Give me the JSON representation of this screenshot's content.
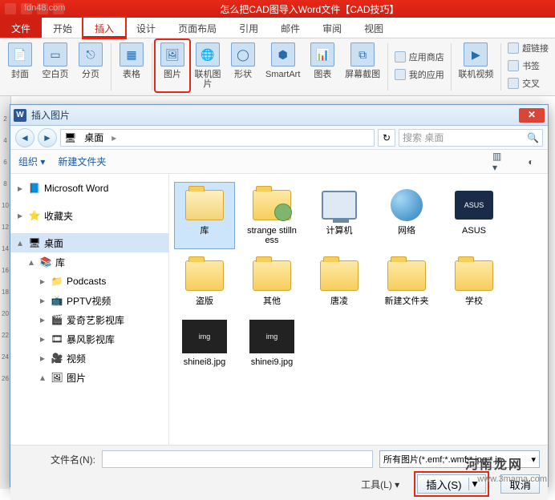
{
  "watermarks": {
    "tl": "fdn48.com",
    "br_site": "河南龙网",
    "br_url": "www.3mama.com"
  },
  "titlebar": {
    "caption": "怎么把CAD图导入Word文件【CAD技巧】"
  },
  "tabs": {
    "file": "文件",
    "items": [
      "开始",
      "插入",
      "设计",
      "页面布局",
      "引用",
      "邮件",
      "审阅",
      "视图"
    ],
    "active_index": 1
  },
  "ribbon": {
    "cover": "封面",
    "blank": "空白页",
    "pagebreak": "分页",
    "table": "表格",
    "picture": "图片",
    "online_pic": "联机图片",
    "shapes": "形状",
    "smartart": "SmartArt",
    "chart": "图表",
    "screenshot": "屏幕截图",
    "appstore": "应用商店",
    "myapps": "我的应用",
    "online_video": "联机视频",
    "hyperlink": "超链接",
    "bookmark": "书签",
    "crossref": "交叉"
  },
  "dialog": {
    "title": "插入图片",
    "crumb": {
      "root_icon": "🖥",
      "root": "桌面",
      "sep": "▸"
    },
    "refresh_icon": "↻",
    "search_placeholder": "搜索 桌面",
    "toolbar": {
      "organize": "组织 ▾",
      "newfolder": "新建文件夹"
    },
    "tree": [
      {
        "kind": "node",
        "twist": "▸",
        "icon": "📘",
        "label": "Microsoft Word",
        "indent": 0
      },
      {
        "kind": "gap"
      },
      {
        "kind": "node",
        "twist": "▸",
        "icon": "⭐",
        "label": "收藏夹",
        "indent": 0
      },
      {
        "kind": "gap"
      },
      {
        "kind": "node",
        "twist": "▴",
        "icon": "🖥",
        "label": "桌面",
        "indent": 0,
        "sel": true
      },
      {
        "kind": "node",
        "twist": "▴",
        "icon": "📚",
        "label": "库",
        "indent": 1
      },
      {
        "kind": "node",
        "twist": "▸",
        "icon": "📁",
        "label": "Podcasts",
        "indent": 2
      },
      {
        "kind": "node",
        "twist": "▸",
        "icon": "📺",
        "label": "PPTV视频",
        "indent": 2
      },
      {
        "kind": "node",
        "twist": "▸",
        "icon": "🎬",
        "label": "爱奇艺影视库",
        "indent": 2
      },
      {
        "kind": "node",
        "twist": "▸",
        "icon": "🎞",
        "label": "暴风影视库",
        "indent": 2
      },
      {
        "kind": "node",
        "twist": "▸",
        "icon": "🎥",
        "label": "视频",
        "indent": 2
      },
      {
        "kind": "node",
        "twist": "▴",
        "icon": "🖼",
        "label": "图片",
        "indent": 2
      }
    ],
    "files": [
      {
        "name": "库",
        "type": "library",
        "sel": true
      },
      {
        "name": "strange stillness",
        "type": "user"
      },
      {
        "name": "计算机",
        "type": "computer"
      },
      {
        "name": "网络",
        "type": "network"
      },
      {
        "name": "ASUS",
        "type": "asus"
      },
      {
        "name": "盗版",
        "type": "folder-special"
      },
      {
        "name": "其他",
        "type": "folder"
      },
      {
        "name": "唐凌",
        "type": "folder"
      },
      {
        "name": "新建文件夹",
        "type": "folder"
      },
      {
        "name": "学校",
        "type": "folder"
      },
      {
        "name": "shinei8.jpg",
        "type": "image"
      },
      {
        "name": "shinei9.jpg",
        "type": "image"
      }
    ],
    "footer": {
      "filename_label": "文件名(N):",
      "tools_label": "工具(L)  ▾",
      "filter_text": "所有图片(*.emf;*.wmf;*.jpg;*.jp",
      "insert_btn": "插入(S)",
      "cancel_btn": "取消"
    }
  }
}
